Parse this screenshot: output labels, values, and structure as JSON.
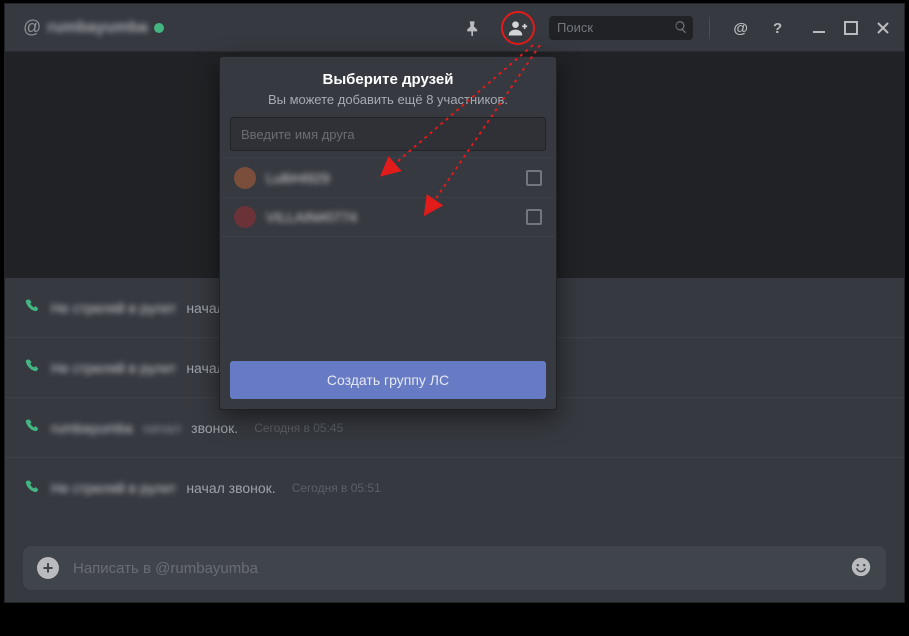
{
  "header": {
    "at": "@",
    "channel_user": "rumbayumba",
    "search_placeholder": "Поиск"
  },
  "popover": {
    "title": "Выберите друзей",
    "subtitle": "Вы можете добавить ещё 8 участников.",
    "search_placeholder": "Введите имя друга",
    "friends": [
      {
        "name": "Lulli#4929"
      },
      {
        "name": "VILLAIN#0774"
      }
    ],
    "create_label": "Создать группу ЛС"
  },
  "messages": [
    {
      "name": "Не стреляй в рулет",
      "text": "начал",
      "ts": ""
    },
    {
      "name": "Не стреляй в рулет",
      "text": "начал",
      "ts": ""
    },
    {
      "name": "rumbayumba",
      "extra": "начал",
      "text": "звонок.",
      "ts": "Сегодня в 05:45"
    },
    {
      "name": "Не стреляй в рулет",
      "text": "начал звонок.",
      "ts": "Сегодня в 05:51"
    }
  ],
  "input": {
    "placeholder": "Написать в @rumbayumba"
  }
}
